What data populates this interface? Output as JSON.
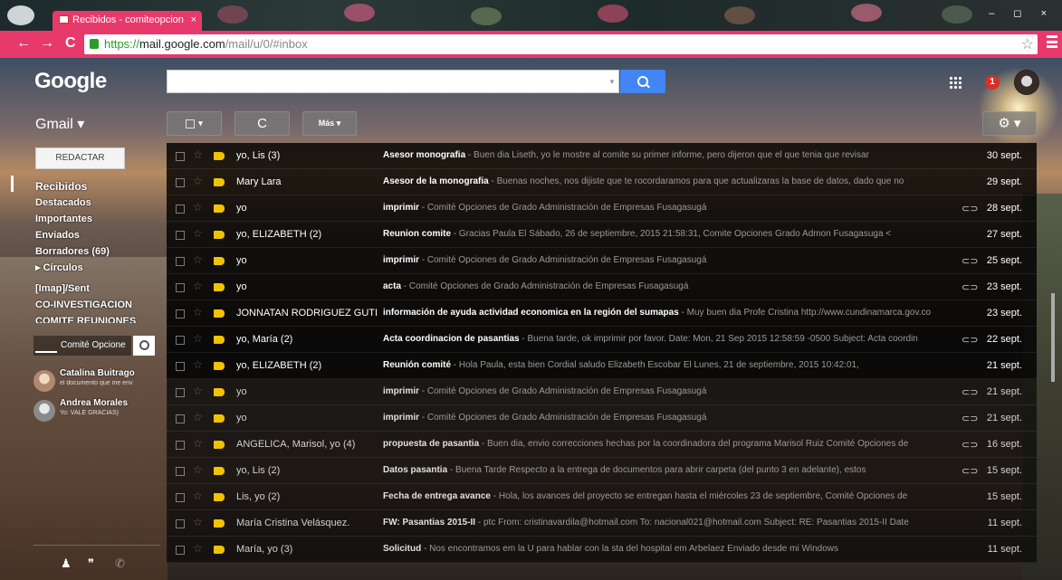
{
  "browser": {
    "tab_title": "Recibidos - comiteopcion",
    "tab_close": "×",
    "url_prefix": "https://",
    "url_host": "mail.google.com",
    "url_path": "/mail/u/0/#inbox",
    "back": "←",
    "forward": "→",
    "reload": "C",
    "window_controls": "– ◻ ×",
    "bookmark_star": "☆"
  },
  "header": {
    "logo": "Google",
    "search_placeholder": "",
    "notification_count": "1",
    "search_dropdown": "▼"
  },
  "toolbar": {
    "app_label": "Gmail ▾",
    "select_caret": "▾",
    "refresh_glyph": "C",
    "more_label": "Más ▾",
    "settings_glyph": "⚙ ▾"
  },
  "sidebar": {
    "compose_label": "REDACTAR",
    "items": [
      {
        "label": "Recibidos"
      },
      {
        "label": "Destacados"
      },
      {
        "label": "Importantes"
      },
      {
        "label": "Enviados"
      },
      {
        "label": "Borradores (69)"
      },
      {
        "label": "▸ Círculos"
      },
      {
        "label": "[Imap]/Sent"
      },
      {
        "label": "CO-INVESTIGACION"
      },
      {
        "label": "COMITE REUNIONES"
      }
    ]
  },
  "chat": {
    "self_name": "Comité Opcione",
    "contacts": [
      {
        "name": "Catalina Buitrago",
        "status": "el documento que me env"
      },
      {
        "name": "Andrea Morales",
        "status": "Yo: VALE GRACIAS)"
      }
    ],
    "footer_icons": [
      "person-icon",
      "hangouts-icon",
      "phone-icon"
    ],
    "footer_glyphs": [
      "♟",
      "❞",
      "✆"
    ]
  },
  "messages": [
    {
      "sender": "yo, Lis (3)",
      "subject": "Asesor monografia",
      "snippet": " - Buen dia Liseth, yo le mostre al comite su primer informe, pero dijeron que el que tenia que revisar",
      "attachment": false,
      "date": "30 sept.",
      "read": false
    },
    {
      "sender": "Mary Lara",
      "subject": "Asesor de la monografia",
      "snippet": " - Buenas noches, nos dijiste que te rocordaramos para que actualizaras la base de datos, dado que no",
      "attachment": false,
      "date": "29 sept.",
      "read": false
    },
    {
      "sender": "yo",
      "subject": "imprimir",
      "snippet": " - Comité Opciones de Grado Administración de Empresas Fusagasugá",
      "attachment": true,
      "date": "28 sept.",
      "read": false
    },
    {
      "sender": "yo, ELIZABETH (2)",
      "subject": "Reunion comite",
      "snippet": " - Gracias Paula El Sábado, 26 de septiembre, 2015 21:58:31, Comite Opciones Grado Admon Fusagasuga <",
      "attachment": false,
      "date": "27 sept.",
      "read": false
    },
    {
      "sender": "yo",
      "subject": "imprimir",
      "snippet": " - Comité Opciones de Grado Administración de Empresas Fusagasugá",
      "attachment": true,
      "date": "25 sept.",
      "read": false
    },
    {
      "sender": "yo",
      "subject": "acta",
      "snippet": " - Comité Opciones de Grado Administración de Empresas Fusagasugá",
      "attachment": true,
      "date": "23 sept.",
      "read": false
    },
    {
      "sender": "JONNATAN RODRIGUEZ GUTI",
      "subject": "información de ayuda actividad economica en la región del sumapas",
      "snippet": " - Muy buen dia Profe Cristina http://www.cundinamarca.gov.co",
      "attachment": false,
      "date": "23 sept.",
      "read": false
    },
    {
      "sender": "yo, María (2)",
      "subject": "Acta coordinacion de pasantias",
      "snippet": " - Buena tarde, ok imprimir por favor. Date: Mon, 21 Sep 2015 12:58:59 -0500 Subject: Acta coordin",
      "attachment": true,
      "date": "22 sept.",
      "read": false
    },
    {
      "sender": "yo, ELIZABETH (2)",
      "subject": "Reunión comité",
      "snippet": " - Hola Paula, esta bien Cordial saludo Elizabeth Escobar El Lunes, 21 de septiembre, 2015 10:42:01,",
      "attachment": false,
      "date": "21 sept.",
      "read": false
    },
    {
      "sender": "yo",
      "subject": "imprimir",
      "snippet": " - Comité Opciones de Grado Administración de Empresas Fusagasugá",
      "attachment": true,
      "date": "21 sept.",
      "read": true
    },
    {
      "sender": "yo",
      "subject": "imprimir",
      "snippet": " - Comité Opciones de Grado Administración de Empresas Fusagasugá",
      "attachment": true,
      "date": "21 sept.",
      "read": true
    },
    {
      "sender": "ANGELICA, Marisol, yo (4)",
      "subject": "propuesta de pasantia",
      "snippet": " - Buen dia, envio correcciones hechas por la coordinadora del programa Marisol Ruiz Comité Opciones de",
      "attachment": true,
      "date": "16 sept.",
      "read": true
    },
    {
      "sender": "yo, Lis (2)",
      "subject": "Datos pasantia",
      "snippet": " - Buena Tarde Respecto a la entrega de documentos para abrir carpeta (del punto 3 en adelante), estos",
      "attachment": true,
      "date": "15 sept.",
      "read": true
    },
    {
      "sender": "Lis, yo (2)",
      "subject": "Fecha de entrega avance",
      "snippet": " - Hola, los avances del proyecto se entregan hasta el miércoles 23 de septiembre, Comité Opciones de",
      "attachment": false,
      "date": "15 sept.",
      "read": true
    },
    {
      "sender": "María Cristina Velásquez.",
      "subject": "FW: Pasantias 2015-II",
      "snippet": " - ptc From: cristinavardila@hotmail.com To: nacional021@hotmail.com Subject: RE: Pasantias 2015-II Date",
      "attachment": false,
      "date": "11 sept.",
      "read": true
    },
    {
      "sender": "María, yo (3)",
      "subject": "Solicitud",
      "snippet": " - Nos encontramos em la U para hablar con la sta del hospital em Arbelaez Enviado desde mi Windows",
      "attachment": false,
      "date": "11 sept.",
      "read": true
    }
  ],
  "colors": {
    "accent": "#e8396b",
    "search_button": "#4285f4",
    "label_tag": "#f2c200",
    "notification": "#d93025"
  }
}
